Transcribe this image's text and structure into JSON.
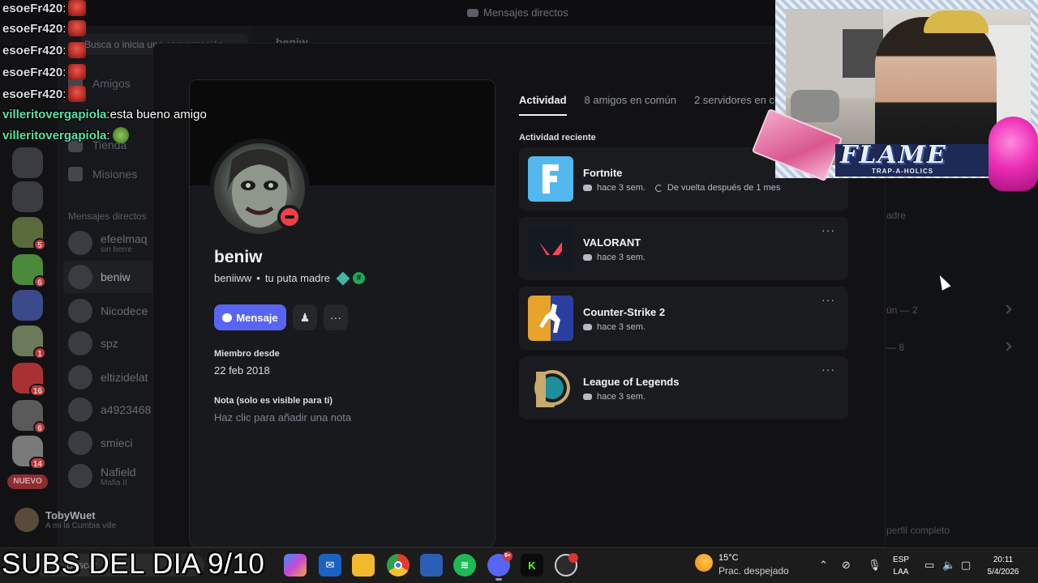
{
  "discord_bg": {
    "window_title": "Mensajes directos",
    "search_placeholder": "Busca o inicia una conversación",
    "nav": [
      "Amigos",
      "Tienda",
      "Misiones"
    ],
    "dm_header": "Mensajes directos",
    "dms": [
      {
        "name": "efeelmaq",
        "sub": "sin berre"
      },
      {
        "name": "beniw",
        "sub": ""
      },
      {
        "name": "Nicodece",
        "sub": ""
      },
      {
        "name": "spz",
        "sub": ""
      },
      {
        "name": "eltizidelat",
        "sub": ""
      },
      {
        "name": "a4923468",
        "sub": ""
      },
      {
        "name": "smieci",
        "sub": ""
      },
      {
        "name": "Nafield",
        "sub": "Mafia II"
      }
    ],
    "server_badges": [
      "5",
      "6",
      "1",
      "16",
      "6",
      "14"
    ],
    "nuevo": "NUEVO",
    "user": {
      "name": "TobyWuet",
      "status": "A mi la Cumbia ville"
    },
    "chat_header": "beniw",
    "right": {
      "line1": "adre",
      "line2": "ún — 2",
      "line3": "— 8",
      "footer": "perfil completo"
    }
  },
  "profile": {
    "display_name": "beniw",
    "username": "beniiww",
    "pronoun_sep": "•",
    "bio": "tu puta madre",
    "message_button": "Mensaje",
    "member_since_label": "Miembro desde",
    "member_since": "22 feb 2018",
    "note_label": "Nota (solo es visible para ti)",
    "note_placeholder": "Haz clic para añadir una nota"
  },
  "tabs": [
    "Actividad",
    "8 amigos en común",
    "2 servidores en común"
  ],
  "recent_label": "Actividad reciente",
  "activities": [
    {
      "name": "Fortnite",
      "time": "hace 3 sem.",
      "extra": "De vuelta después de 1 mes",
      "color": "#35a8e6"
    },
    {
      "name": "VALORANT",
      "time": "hace 3 sem.",
      "extra": "",
      "color": "#ff4655"
    },
    {
      "name": "Counter-Strike 2",
      "time": "hace 3 sem.",
      "extra": "",
      "color": "#e0a02a"
    },
    {
      "name": "League of Legends",
      "time": "hace 3 sem.",
      "extra": "",
      "color": "#c8aa6e"
    }
  ],
  "chat": [
    {
      "user": "esoeFr420",
      "color": "#ffffff",
      "msg": "",
      "emote": "red"
    },
    {
      "user": "esoeFr420",
      "color": "#ffffff",
      "msg": "",
      "emote": "red"
    },
    {
      "user": "esoeFr420",
      "color": "#ffffff",
      "msg": "",
      "emote": "red"
    },
    {
      "user": "esoeFr420",
      "color": "#ffffff",
      "msg": "",
      "emote": "red"
    },
    {
      "user": "esoeFr420",
      "color": "#ffffff",
      "msg": "",
      "emote": "red"
    },
    {
      "user": "villeritovergapiola",
      "color": "#59e3a6",
      "msg": " esta bueno amigo",
      "emote": ""
    },
    {
      "user": "villeritovergapiola",
      "color": "#59e3a6",
      "msg": "",
      "emote": "frog"
    }
  ],
  "overlay": {
    "flame": "FLAME",
    "flame_sub": "TRAP-A-HOLICS",
    "subs": "SUBS DEL DIA 9/10"
  },
  "taskbar": {
    "search": "Buscar",
    "discord_badge": "9+",
    "weather_temp": "15°C",
    "weather_desc": "Prac. despejado",
    "lang1": "ESP",
    "lang2": "LAA",
    "time": "20:11",
    "date": "5/4/2026"
  }
}
